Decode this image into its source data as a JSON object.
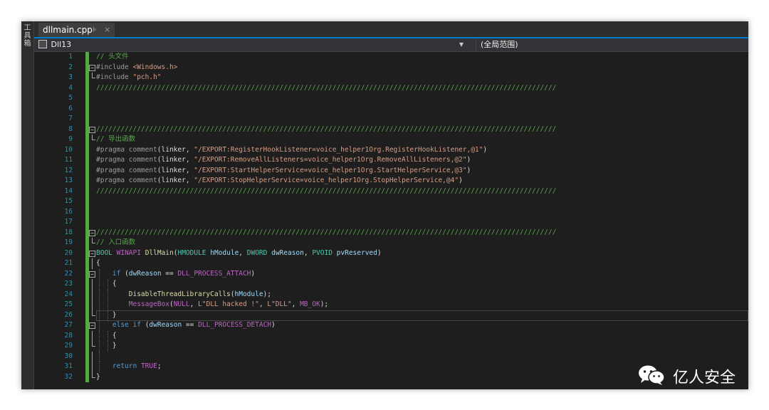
{
  "side_panel": {
    "label": "工具箱"
  },
  "tabs": [
    {
      "label": "dllmain.cpp",
      "pin": "⊧",
      "close": "×"
    }
  ],
  "nav": {
    "project": "Dll13",
    "scope": "(全局范围)"
  },
  "lines": [
    {
      "n": "1",
      "t": [
        [
          "cm",
          "// 头文件"
        ]
      ]
    },
    {
      "n": "2",
      "t": [
        [
          "pp",
          "#include "
        ],
        [
          "str",
          "<Windows.h>"
        ]
      ]
    },
    {
      "n": "3",
      "t": [
        [
          "pp",
          "#include "
        ],
        [
          "str",
          "\"pch.h\""
        ]
      ]
    },
    {
      "n": "4",
      "t": [
        [
          "cm",
          "/////////////////////////////////////////////////////////////////////////////////////////////////////////////////"
        ]
      ]
    },
    {
      "n": "5",
      "t": []
    },
    {
      "n": "6",
      "t": []
    },
    {
      "n": "7",
      "t": []
    },
    {
      "n": "8",
      "t": [
        [
          "cm",
          "/////////////////////////////////////////////////////////////////////////////////////////////////////////////////"
        ]
      ]
    },
    {
      "n": "9",
      "t": [
        [
          "cm",
          "// 导出函数"
        ]
      ]
    },
    {
      "n": "10",
      "t": [
        [
          "pp",
          "#pragma comment"
        ],
        [
          "pl",
          "(linker, "
        ],
        [
          "str",
          "\"/EXPORT:RegisterHookListener=voice_helper1Org.RegisterHookListener,@1\""
        ],
        [
          "pl",
          ")"
        ]
      ]
    },
    {
      "n": "11",
      "t": [
        [
          "pp",
          "#pragma comment"
        ],
        [
          "pl",
          "(linker, "
        ],
        [
          "str",
          "\"/EXPORT:RemoveAllListeners=voice_helper1Org.RemoveAllListeners,@2\""
        ],
        [
          "pl",
          ")"
        ]
      ]
    },
    {
      "n": "12",
      "t": [
        [
          "pp",
          "#pragma comment"
        ],
        [
          "pl",
          "(linker, "
        ],
        [
          "str",
          "\"/EXPORT:StartHelperService=voice_helper1Org.StartHelperService,@3\""
        ],
        [
          "pl",
          ")"
        ]
      ]
    },
    {
      "n": "13",
      "t": [
        [
          "pp",
          "#pragma comment"
        ],
        [
          "pl",
          "(linker, "
        ],
        [
          "str",
          "\"/EXPORT:StopHelperService=voice_helper1Org.StopHelperService,@4\""
        ],
        [
          "pl",
          ")"
        ]
      ]
    },
    {
      "n": "14",
      "t": [
        [
          "cm",
          "/////////////////////////////////////////////////////////////////////////////////////////////////////////////////"
        ]
      ]
    },
    {
      "n": "15",
      "t": []
    },
    {
      "n": "16",
      "t": []
    },
    {
      "n": "17",
      "t": []
    },
    {
      "n": "18",
      "t": [
        [
          "cm",
          "/////////////////////////////////////////////////////////////////////////////////////////////////////////////////"
        ]
      ]
    },
    {
      "n": "19",
      "t": [
        [
          "cm",
          "// 入口函数"
        ]
      ]
    },
    {
      "n": "20",
      "t": [
        [
          "ty",
          "BOOL"
        ],
        [
          "pl",
          " "
        ],
        [
          "mac",
          "WINAPI"
        ],
        [
          "pl",
          " "
        ],
        [
          "fn",
          "DllMain"
        ],
        [
          "pl",
          "("
        ],
        [
          "ty",
          "HMODULE"
        ],
        [
          "pl",
          " "
        ],
        [
          "par",
          "hModule"
        ],
        [
          "pl",
          ", "
        ],
        [
          "ty",
          "DWORD"
        ],
        [
          "pl",
          " "
        ],
        [
          "par",
          "dwReason"
        ],
        [
          "pl",
          ", "
        ],
        [
          "ty",
          "PVOID"
        ],
        [
          "pl",
          " "
        ],
        [
          "par",
          "pvReserved"
        ],
        [
          "pl",
          ")"
        ]
      ]
    },
    {
      "n": "21",
      "t": [
        [
          "pl",
          "{"
        ]
      ]
    },
    {
      "n": "22",
      "t": [
        [
          "pl",
          "    "
        ],
        [
          "kw",
          "if"
        ],
        [
          "pl",
          " ("
        ],
        [
          "par",
          "dwReason"
        ],
        [
          "pl",
          " == "
        ],
        [
          "mac",
          "DLL_PROCESS_ATTACH"
        ],
        [
          "pl",
          ")"
        ]
      ]
    },
    {
      "n": "23",
      "t": [
        [
          "pl",
          "    {"
        ]
      ]
    },
    {
      "n": "24",
      "t": [
        [
          "pl",
          "        "
        ],
        [
          "fn",
          "DisableThreadLibraryCalls"
        ],
        [
          "pl",
          "("
        ],
        [
          "par",
          "hModule"
        ],
        [
          "pl",
          ");"
        ]
      ]
    },
    {
      "n": "25",
      "t": [
        [
          "pl",
          "        "
        ],
        [
          "mac",
          "MessageBox"
        ],
        [
          "pl",
          "("
        ],
        [
          "mac",
          "NULL"
        ],
        [
          "pl",
          ", "
        ],
        [
          "str",
          "L\"DLL hacked !\""
        ],
        [
          "pl",
          ", "
        ],
        [
          "str",
          "L\"DLL\""
        ],
        [
          "pl",
          ", "
        ],
        [
          "mac",
          "MB_OK"
        ],
        [
          "pl",
          ");"
        ]
      ]
    },
    {
      "n": "26",
      "t": [
        [
          "pl",
          "    }"
        ]
      ]
    },
    {
      "n": "27",
      "t": [
        [
          "pl",
          "    "
        ],
        [
          "kw",
          "else"
        ],
        [
          "pl",
          " "
        ],
        [
          "kw",
          "if"
        ],
        [
          "pl",
          " ("
        ],
        [
          "par",
          "dwReason"
        ],
        [
          "pl",
          " == "
        ],
        [
          "mac",
          "DLL_PROCESS_DETACH"
        ],
        [
          "pl",
          ")"
        ]
      ]
    },
    {
      "n": "28",
      "t": [
        [
          "pl",
          "    {"
        ]
      ]
    },
    {
      "n": "29",
      "t": [
        [
          "pl",
          "    }"
        ]
      ]
    },
    {
      "n": "30",
      "t": []
    },
    {
      "n": "31",
      "t": [
        [
          "pl",
          "    "
        ],
        [
          "kw",
          "return"
        ],
        [
          "pl",
          " "
        ],
        [
          "mac",
          "TRUE"
        ],
        [
          "pl",
          ";"
        ]
      ]
    },
    {
      "n": "32",
      "t": [
        [
          "pl",
          "}"
        ]
      ]
    }
  ],
  "watermark": {
    "text": "亿人安全"
  },
  "colors": {
    "editor_bg": "#1e1e1e",
    "comment": "#57a64a",
    "string": "#d69d85",
    "keyword": "#569cd6",
    "type": "#4ec9b0",
    "line_number": "#2b91af",
    "accent": "#007acc"
  },
  "icons": {
    "tab_pin": "pin-icon",
    "tab_close": "close-icon",
    "project": "cpp-project-icon",
    "dropdown": "chevron-down-icon",
    "watermark": "wechat-icon"
  }
}
